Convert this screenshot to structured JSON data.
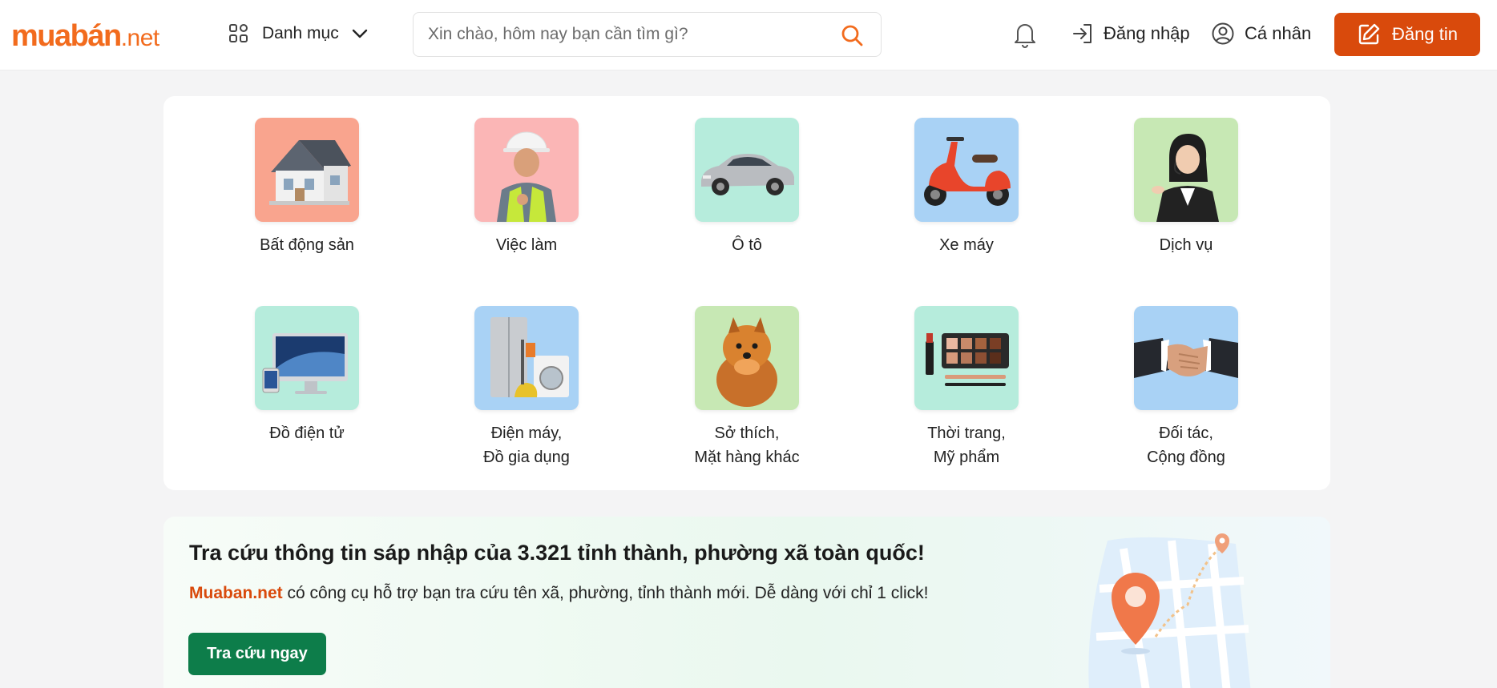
{
  "header": {
    "logo_main": "muabán",
    "logo_net": ".net",
    "category_label": "Danh mục",
    "search_placeholder": "Xin chào, hôm nay bạn cần tìm gì?",
    "login_label": "Đăng nhập",
    "profile_label": "Cá nhân",
    "post_label": "Đăng tin"
  },
  "categories": [
    {
      "label": "Bất động sản",
      "bg": "#f9a48e",
      "icon": "house-icon"
    },
    {
      "label": "Việc làm",
      "bg": "#fbb6b6",
      "icon": "worker-icon"
    },
    {
      "label": "Ô tô",
      "bg": "#b6ecdc",
      "icon": "car-icon"
    },
    {
      "label": "Xe máy",
      "bg": "#a9d2f5",
      "icon": "scooter-icon"
    },
    {
      "label": "Dịch vụ",
      "bg": "#c7e8b4",
      "icon": "support-agent-icon"
    },
    {
      "label": "Đồ điện tử",
      "bg": "#b6ecdc",
      "icon": "computer-icon"
    },
    {
      "label": "Điện máy,\nĐồ gia dụng",
      "bg": "#a9d2f5",
      "icon": "appliance-icon"
    },
    {
      "label": "Sở thích,\nMặt hàng khác",
      "bg": "#c7e8b4",
      "icon": "dog-icon"
    },
    {
      "label": "Thời trang,\nMỹ phẩm",
      "bg": "#b6ecdc",
      "icon": "makeup-icon"
    },
    {
      "label": "Đối tác,\nCộng đồng",
      "bg": "#a9d2f5",
      "icon": "handshake-icon"
    }
  ],
  "promo": {
    "title": "Tra cứu thông tin sáp nhập của 3.321 tỉnh thành, phường xã toàn quốc!",
    "brand": "Muaban.net",
    "desc": " có công cụ hỗ trợ bạn tra cứu tên xã, phường, tỉnh thành mới. Dễ dàng với chỉ 1 click!",
    "button": "Tra cứu ngay"
  },
  "colors": {
    "brand_orange": "#f26b1d",
    "post_button": "#d94a0c",
    "promo_button": "#0d7d4a"
  }
}
